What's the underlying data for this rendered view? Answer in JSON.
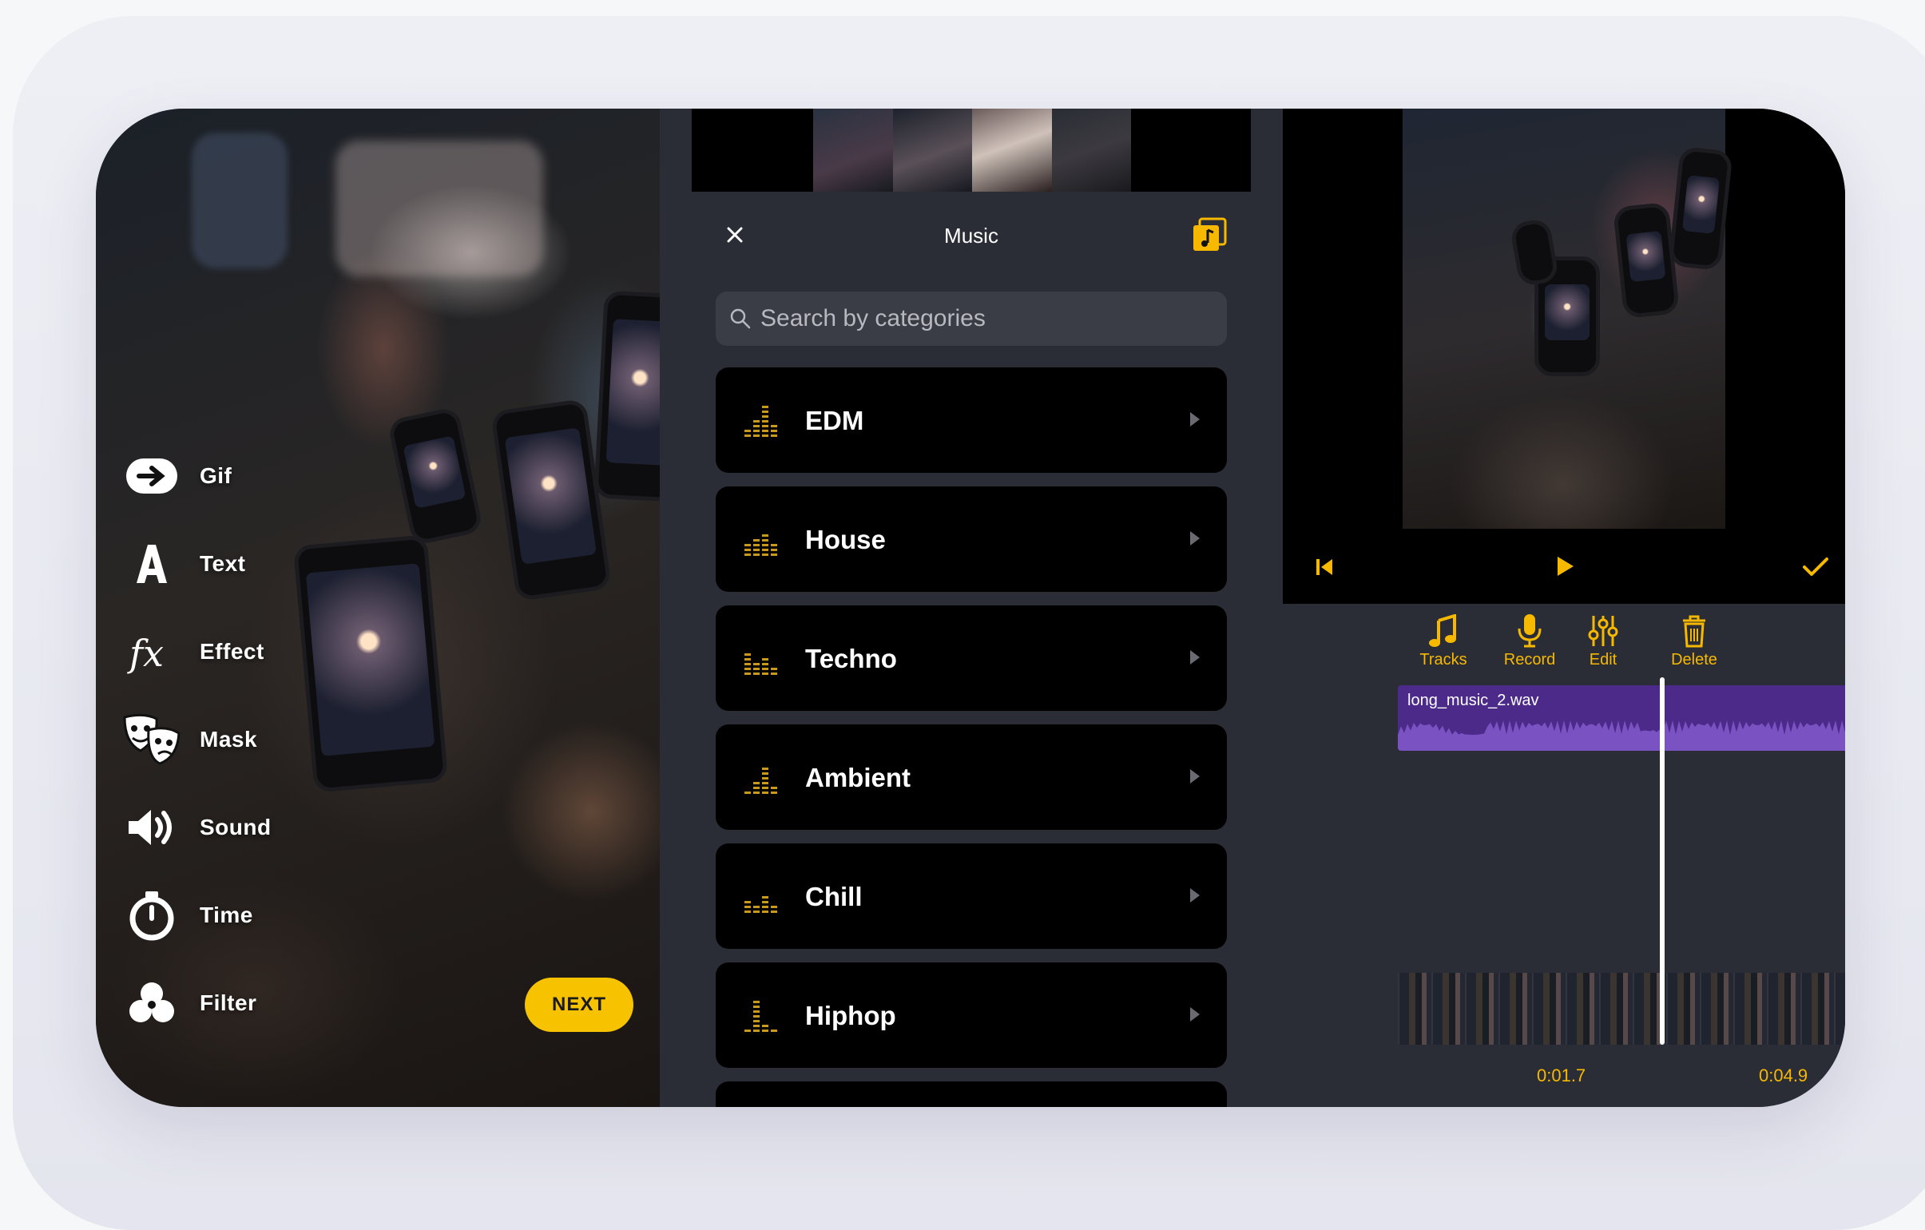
{
  "colors": {
    "accent": "#f6b900",
    "track": "#4b2a8a",
    "panel_bg": "#2b2d36",
    "card_bg": "#000000"
  },
  "editor_tools": [
    {
      "label": "Gif",
      "icon": "gif-icon"
    },
    {
      "label": "Text",
      "icon": "text-icon"
    },
    {
      "label": "Effect",
      "icon": "fx-icon"
    },
    {
      "label": "Mask",
      "icon": "mask-icon"
    },
    {
      "label": "Sound",
      "icon": "speaker-icon"
    },
    {
      "label": "Time",
      "icon": "stopwatch-icon"
    },
    {
      "label": "Filter",
      "icon": "filter-icon"
    }
  ],
  "next_button": {
    "label": "NEXT"
  },
  "music_panel": {
    "title": "Music",
    "close_icon": "close-icon",
    "library_icon": "music-library-icon",
    "search": {
      "placeholder": "Search by categories",
      "value": ""
    },
    "categories": [
      {
        "label": "EDM"
      },
      {
        "label": "House"
      },
      {
        "label": "Techno"
      },
      {
        "label": "Ambient"
      },
      {
        "label": "Chill"
      },
      {
        "label": "Hiphop"
      }
    ]
  },
  "audio_editor": {
    "controls": [
      "skip-back-icon",
      "play-icon",
      "checkmark-icon"
    ],
    "toolbar": [
      {
        "label": "Tracks",
        "icon": "music-note-icon"
      },
      {
        "label": "Record",
        "icon": "microphone-icon"
      },
      {
        "label": "Edit",
        "icon": "sliders-icon"
      },
      {
        "label": "Delete",
        "icon": "trash-icon"
      }
    ],
    "track": {
      "filename": "long_music_2.wav"
    },
    "time_current": "0:01.7",
    "time_total": "0:04.9"
  }
}
